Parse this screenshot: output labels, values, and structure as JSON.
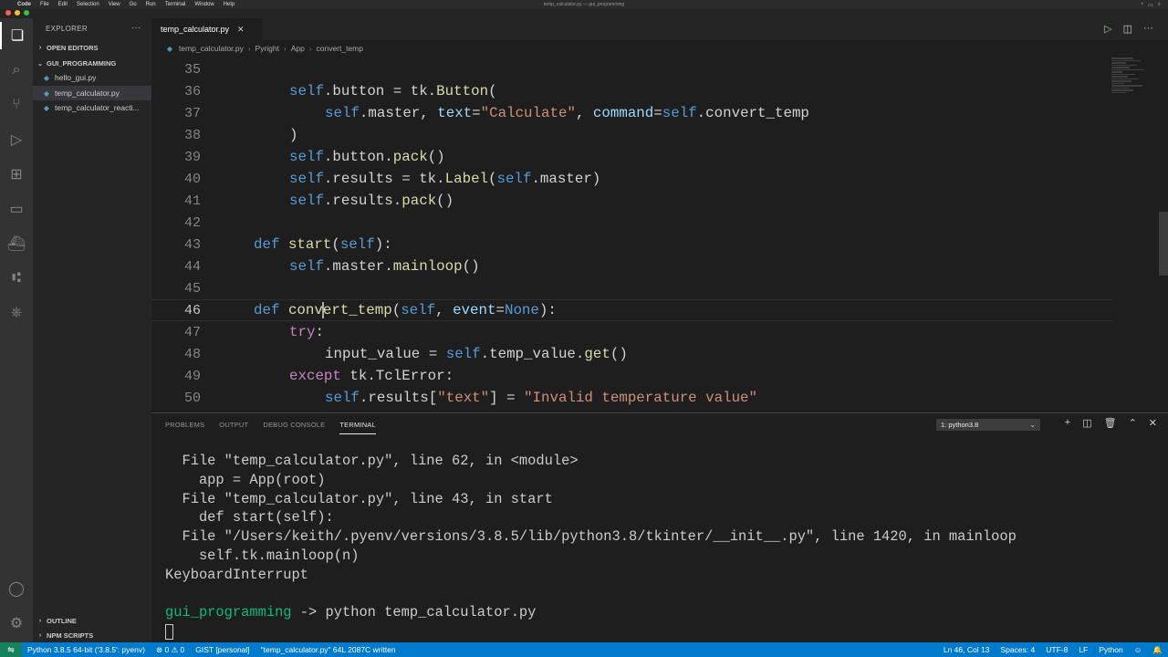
{
  "menubar": {
    "app": "Code",
    "items": [
      "File",
      "Edit",
      "Selection",
      "View",
      "Go",
      "Run",
      "Terminal",
      "Window",
      "Help"
    ],
    "window_title": "temp_calculator.py — gui_programming"
  },
  "sidebar": {
    "title": "EXPLORER",
    "open_editors": "OPEN EDITORS",
    "folder": "GUI_PROGRAMMING",
    "files": [
      "hello_gui.py",
      "temp_calculator.py",
      "temp_calculator_reacti..."
    ],
    "outline": "OUTLINE",
    "npm_scripts": "NPM SCRIPTS"
  },
  "editor": {
    "tab": "temp_calculator.py",
    "breadcrumb": [
      "temp_calculator.py",
      "Pyright",
      "App",
      "convert_temp"
    ],
    "line_numbers": [
      "35",
      "36",
      "37",
      "38",
      "39",
      "40",
      "41",
      "42",
      "43",
      "44",
      "45",
      "46",
      "47",
      "48",
      "49",
      "50"
    ]
  },
  "panel": {
    "tabs": [
      "PROBLEMS",
      "OUTPUT",
      "DEBUG CONSOLE",
      "TERMINAL"
    ],
    "active_tab": "TERMINAL",
    "terminal_select": "1: python3.8",
    "lines": [
      "  File \"temp_calculator.py\", line 62, in <module>",
      "    app = App(root)",
      "  File \"temp_calculator.py\", line 43, in start",
      "    def start(self):",
      "  File \"/Users/keith/.pyenv/versions/3.8.5/lib/python3.8/tkinter/__init__.py\", line 1420, in mainloop",
      "    self.tk.mainloop(n)",
      "KeyboardInterrupt"
    ],
    "prompt_dir": "gui_programming",
    "prompt_arrow": " -> ",
    "prompt_cmd": "python temp_calculator.py"
  },
  "statusbar": {
    "interpreter": "Python 3.8.5 64-bit ('3.8.5': pyenv)",
    "errors": "0",
    "warnings": "0",
    "gist": "GIST [personal]",
    "message": "\"temp_calculator.py\" 64L 2087C written",
    "position": "Ln 46, Col 13",
    "spaces": "Spaces: 4",
    "encoding": "UTF-8",
    "eol": "LF",
    "language": "Python"
  },
  "colors": {
    "accent": "#007acc",
    "keyword": "#c586c0",
    "function": "#dcdcaa",
    "string": "#ce9178",
    "self": "#569cd6",
    "terminal_prompt": "#0dbc79"
  }
}
